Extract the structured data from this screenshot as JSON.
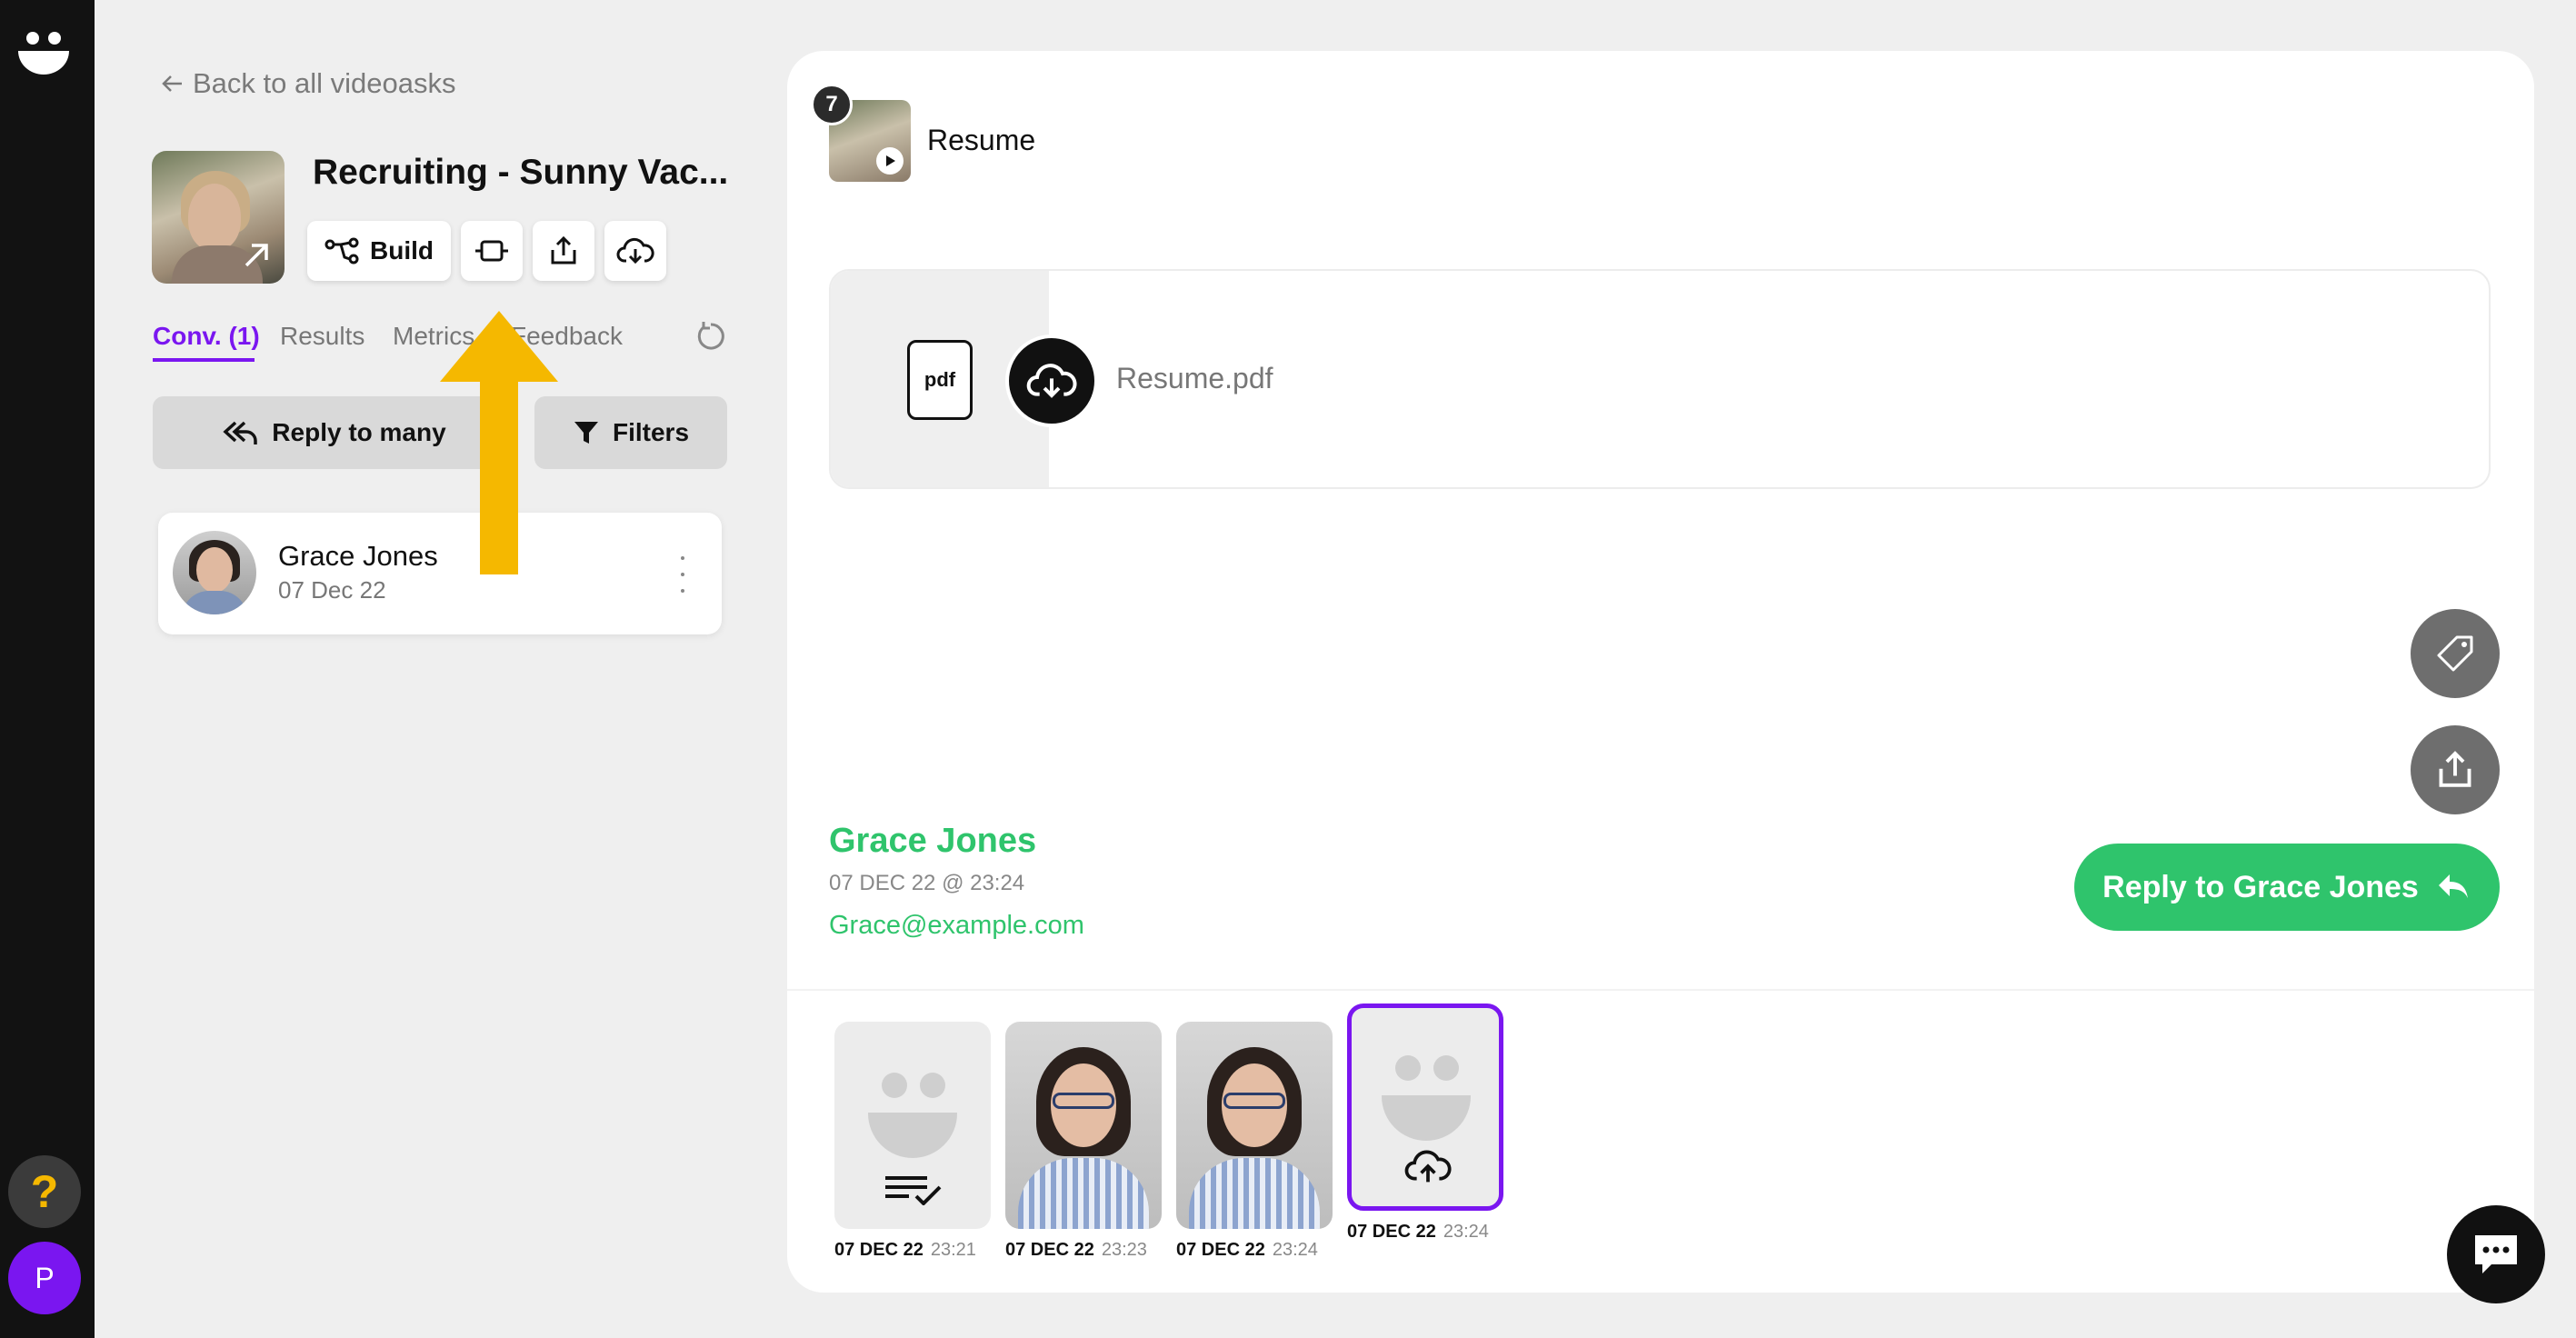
{
  "sidebar": {
    "back_label": "Back to all videoasks",
    "ask_title": "Recruiting - Sunny Vac...",
    "build_label": "Build",
    "tabs": [
      {
        "label": "Conv. (1)"
      },
      {
        "label": "Results"
      },
      {
        "label": "Metrics"
      },
      {
        "label": "Feedback"
      }
    ],
    "reply_many_label": "Reply to many",
    "filters_label": "Filters",
    "conversation": {
      "name": "Grace Jones",
      "date": "07 Dec 22"
    }
  },
  "rail": {
    "avatar_initial": "P",
    "help_glyph": "?"
  },
  "main": {
    "step_number": "7",
    "step_title": "Resume",
    "file": {
      "type_label": "pdf",
      "name": "Resume.pdf"
    },
    "respondent": {
      "name": "Grace Jones",
      "datetime": "07 DEC 22 @ 23:24",
      "email": "Grace@example.com"
    },
    "reply_button_label": "Reply to Grace Jones",
    "clips": [
      {
        "date": "07 DEC 22",
        "time": "23:21",
        "kind": "text-response"
      },
      {
        "date": "07 DEC 22",
        "time": "23:23",
        "kind": "video"
      },
      {
        "date": "07 DEC 22",
        "time": "23:24",
        "kind": "video"
      },
      {
        "date": "07 DEC 22",
        "time": "23:24",
        "kind": "file-upload",
        "selected": true
      }
    ]
  },
  "colors": {
    "accent": "#7a16f0",
    "green": "#2fc46c",
    "annotation": "#f5b800"
  },
  "icons": [
    "smile-logo-icon",
    "arrow-left-icon",
    "build-flow-icon",
    "split-icon",
    "share-icon",
    "cloud-download-icon",
    "refresh-icon",
    "reply-all-icon",
    "filter-icon",
    "more-vertical-icon",
    "play-icon",
    "pdf-file-icon",
    "tag-icon",
    "reply-icon",
    "cloud-upload-icon",
    "chat-icon"
  ]
}
